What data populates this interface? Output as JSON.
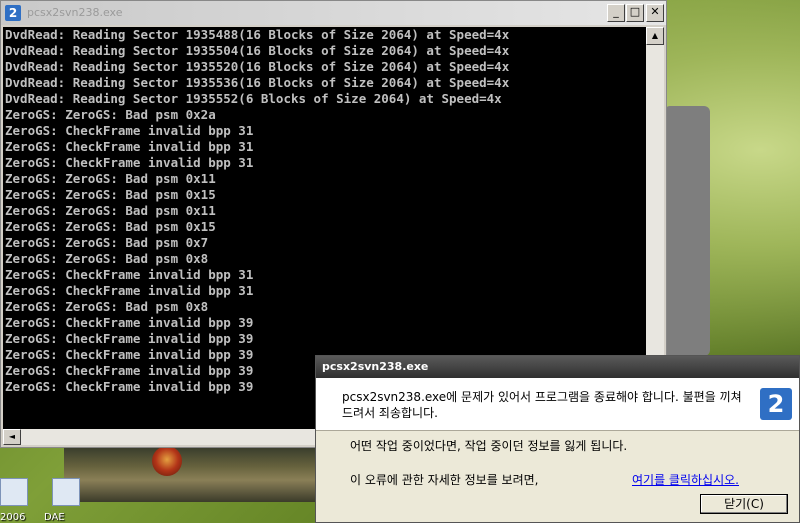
{
  "desktop": {
    "icon_label_1": "2006",
    "icon_label_2": "DAE"
  },
  "console": {
    "title": "pcsx2svn238.exe",
    "minimize_glyph": "_",
    "maximize_glyph": "□",
    "close_glyph": "✕",
    "lines": [
      "DvdRead: Reading Sector 1935488(16 Blocks of Size 2064) at Speed=4x",
      "DvdRead: Reading Sector 1935504(16 Blocks of Size 2064) at Speed=4x",
      "DvdRead: Reading Sector 1935520(16 Blocks of Size 2064) at Speed=4x",
      "DvdRead: Reading Sector 1935536(16 Blocks of Size 2064) at Speed=4x",
      "DvdRead: Reading Sector 1935552(6 Blocks of Size 2064) at Speed=4x",
      "ZeroGS: ZeroGS: Bad psm 0x2a",
      "ZeroGS: CheckFrame invalid bpp 31",
      "ZeroGS: CheckFrame invalid bpp 31",
      "ZeroGS: CheckFrame invalid bpp 31",
      "ZeroGS: ZeroGS: Bad psm 0x11",
      "ZeroGS: ZeroGS: Bad psm 0x15",
      "ZeroGS: ZeroGS: Bad psm 0x11",
      "ZeroGS: ZeroGS: Bad psm 0x15",
      "ZeroGS: ZeroGS: Bad psm 0x7",
      "ZeroGS: ZeroGS: Bad psm 0x8",
      "ZeroGS: CheckFrame invalid bpp 31",
      "ZeroGS: CheckFrame invalid bpp 31",
      "ZeroGS: ZeroGS: Bad psm 0x8",
      "ZeroGS: CheckFrame invalid bpp 39",
      "ZeroGS: CheckFrame invalid bpp 39",
      "ZeroGS: CheckFrame invalid bpp 39",
      "ZeroGS: CheckFrame invalid bpp 39",
      "ZeroGS: CheckFrame invalid bpp 39"
    ],
    "scroll_up_glyph": "▲",
    "scroll_left_glyph": "◄"
  },
  "dialog": {
    "title": "pcsx2svn238.exe",
    "message": "pcsx2svn238.exe에 문제가 있어서 프로그램을 종료해야 합니다. 불편을 끼쳐드려서 죄송합니다.",
    "info_line": "어떤 작업 중이었다면, 작업 중이던 정보를 잃게 됩니다.",
    "details_prompt": "이 오류에 관한 자세한 정보를 보려면,",
    "details_link": "여기를 클릭하십시오.",
    "close_button": "닫기(C)",
    "app_icon_glyph": "2"
  },
  "colors": {
    "console_bg": "#000000",
    "console_text": "#c0c0c0",
    "link": "#0000ee",
    "accent": "#2f6fc4"
  }
}
